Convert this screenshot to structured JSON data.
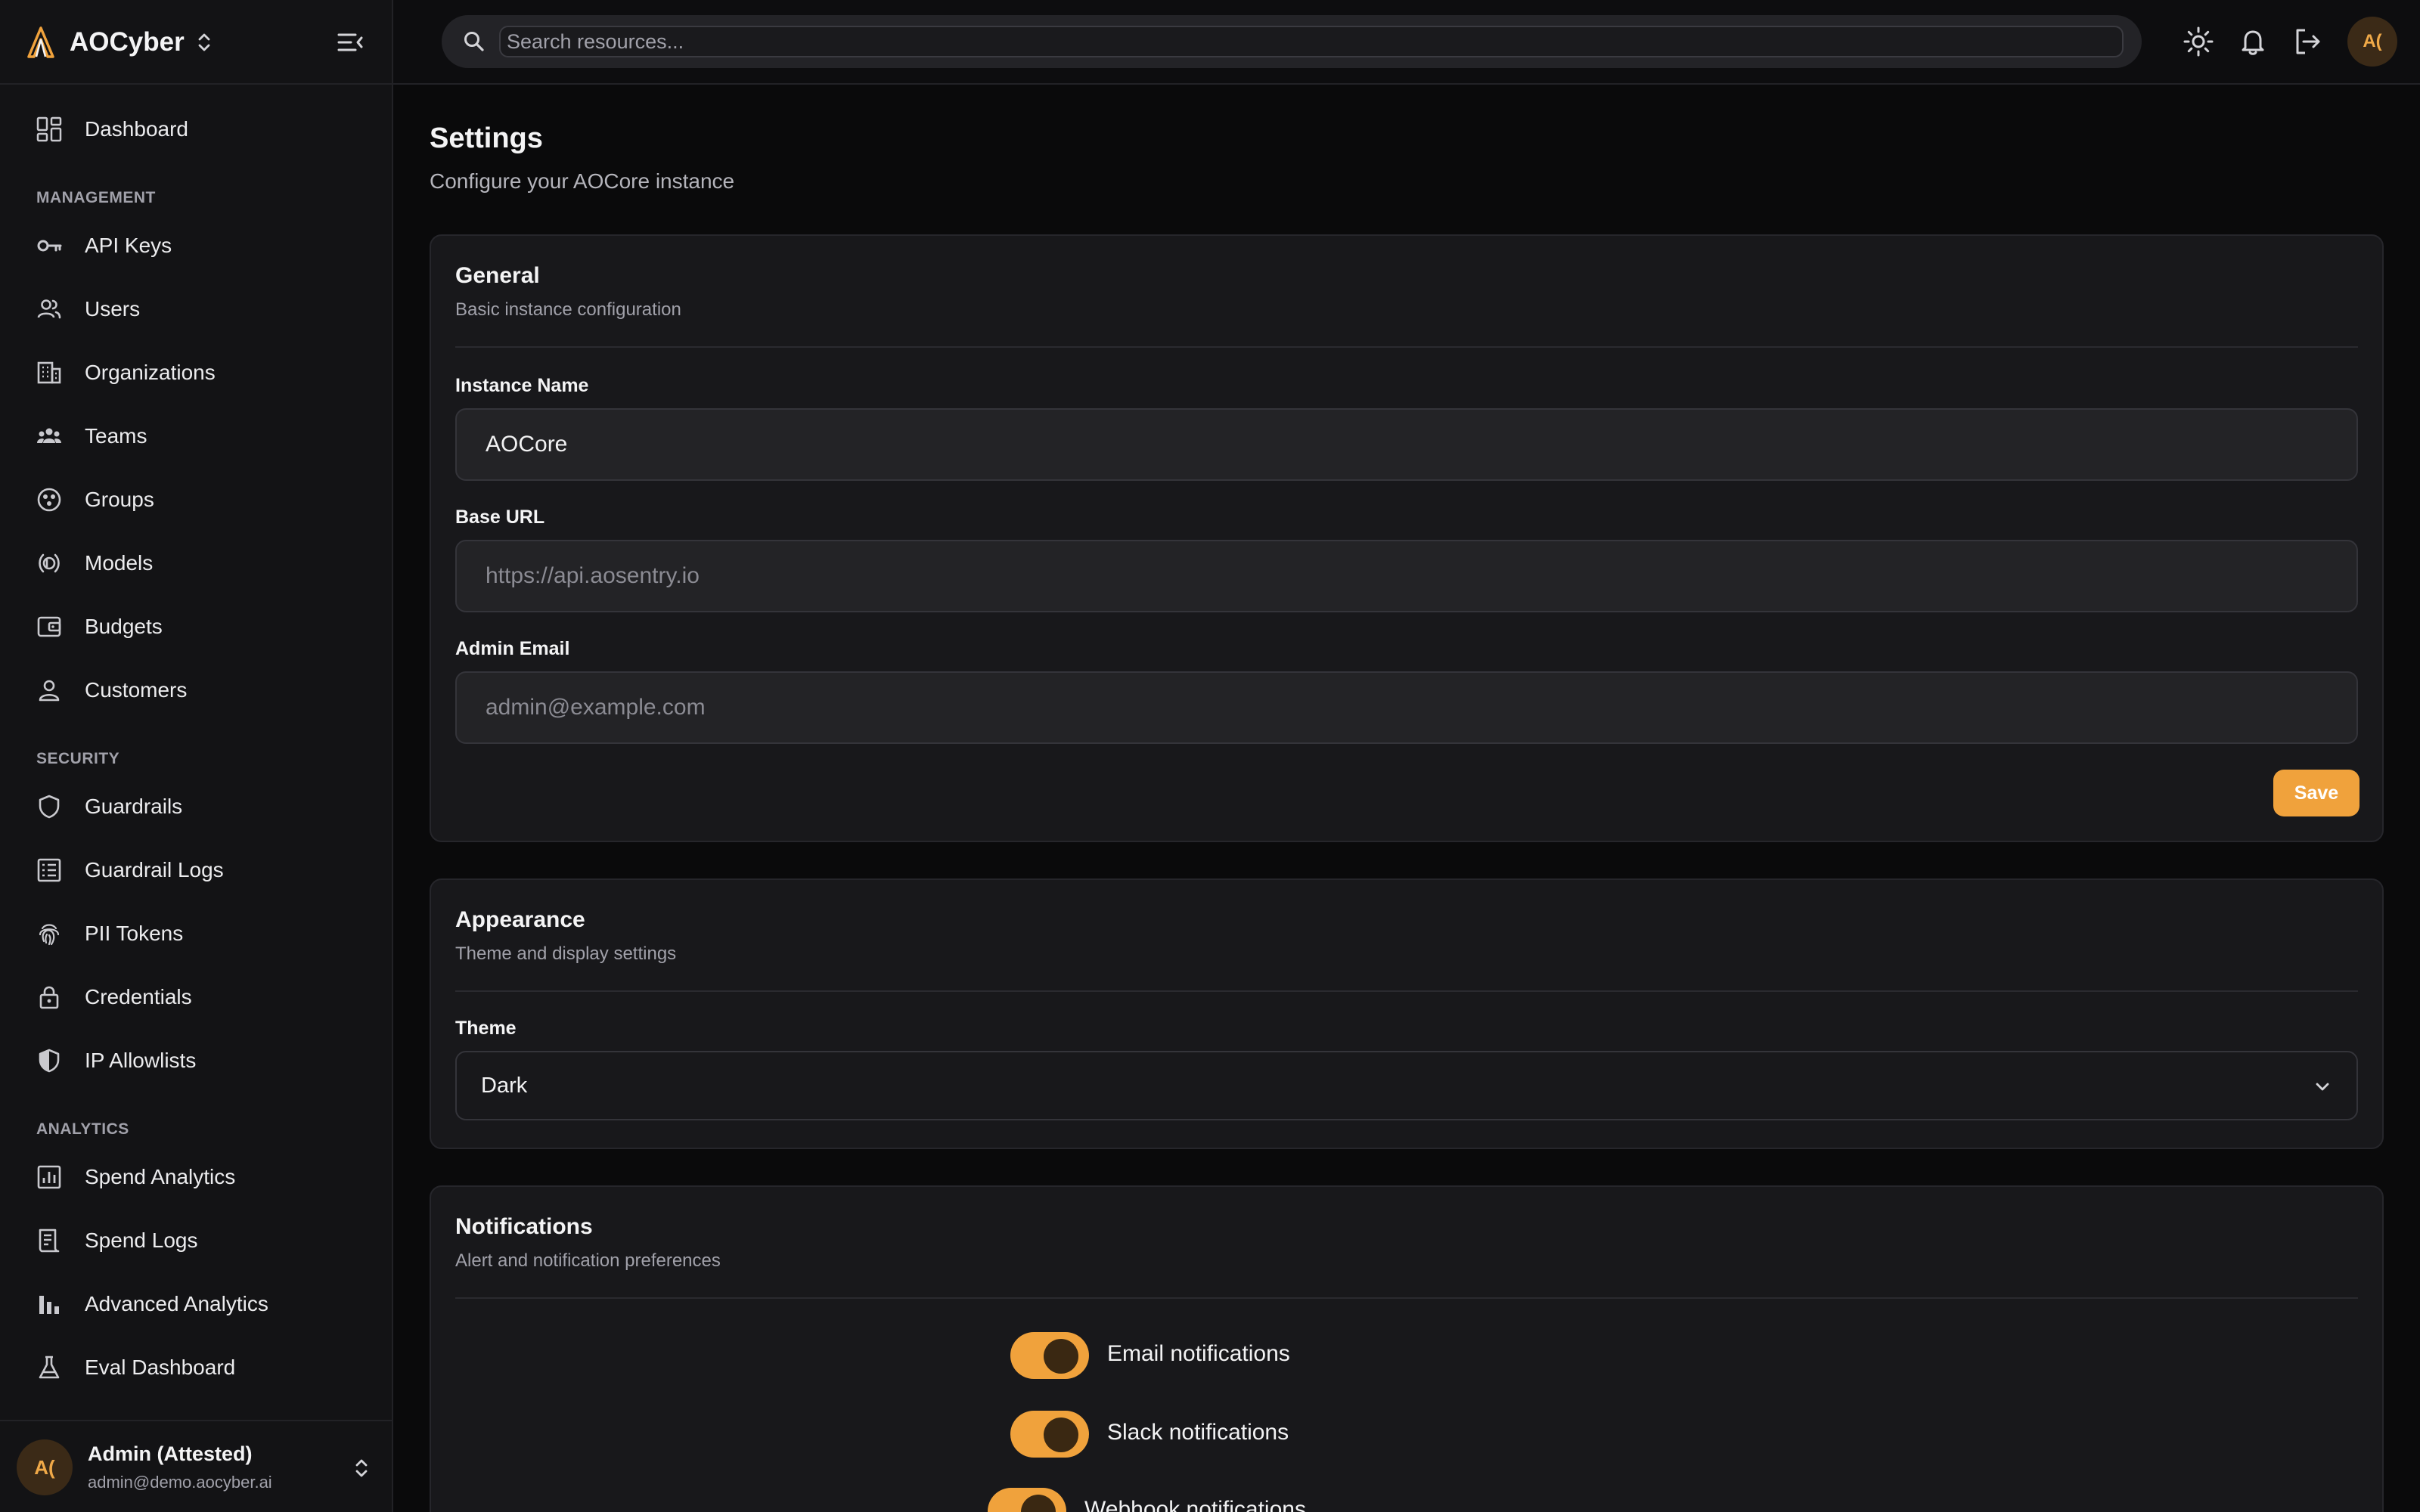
{
  "brand": {
    "name": "AOCyber"
  },
  "sidebar": {
    "dashboard": "Dashboard",
    "sections": {
      "management": "MANAGEMENT",
      "security": "SECURITY",
      "analytics": "ANALYTICS"
    },
    "management_items": [
      {
        "label": "API Keys",
        "icon": "key-icon"
      },
      {
        "label": "Users",
        "icon": "users-icon"
      },
      {
        "label": "Organizations",
        "icon": "building-icon"
      },
      {
        "label": "Teams",
        "icon": "team-icon"
      },
      {
        "label": "Groups",
        "icon": "groups-icon"
      },
      {
        "label": "Models",
        "icon": "model-icon"
      },
      {
        "label": "Budgets",
        "icon": "wallet-icon"
      },
      {
        "label": "Customers",
        "icon": "person-icon"
      }
    ],
    "security_items": [
      {
        "label": "Guardrails",
        "icon": "shield-icon"
      },
      {
        "label": "Guardrail Logs",
        "icon": "log-list-icon"
      },
      {
        "label": "PII Tokens",
        "icon": "fingerprint-icon"
      },
      {
        "label": "Credentials",
        "icon": "lock-icon"
      },
      {
        "label": "IP Allowlists",
        "icon": "shield-half-icon"
      }
    ],
    "analytics_items": [
      {
        "label": "Spend Analytics",
        "icon": "analytics-icon"
      },
      {
        "label": "Spend Logs",
        "icon": "receipt-icon"
      },
      {
        "label": "Advanced Analytics",
        "icon": "bar-chart-icon"
      },
      {
        "label": "Eval Dashboard",
        "icon": "flask-icon"
      }
    ]
  },
  "user": {
    "initials": "A(",
    "name": "Admin (Attested)",
    "email": "admin@demo.aocyber.ai"
  },
  "topbar": {
    "search_placeholder": "Search resources...",
    "avatar_initials": "A("
  },
  "page": {
    "title": "Settings",
    "subtitle": "Configure your AOCore instance"
  },
  "general": {
    "title": "General",
    "description": "Basic instance configuration",
    "instance_name_label": "Instance Name",
    "instance_name_value": "AOCore",
    "base_url_label": "Base URL",
    "base_url_placeholder": "https://api.aosentry.io",
    "admin_email_label": "Admin Email",
    "admin_email_placeholder": "admin@example.com",
    "save_label": "Save"
  },
  "appearance": {
    "title": "Appearance",
    "description": "Theme and display settings",
    "theme_label": "Theme",
    "theme_value": "Dark"
  },
  "notifications": {
    "title": "Notifications",
    "description": "Alert and notification preferences",
    "toggles": [
      {
        "label": "Email notifications",
        "enabled": true
      },
      {
        "label": "Slack notifications",
        "enabled": true
      },
      {
        "label": "Webhook notifications",
        "enabled": true
      }
    ]
  },
  "colors": {
    "accent": "#f0a23c",
    "background": "#0a0a0b",
    "card": "#18181b",
    "sidebar": "#131315"
  }
}
